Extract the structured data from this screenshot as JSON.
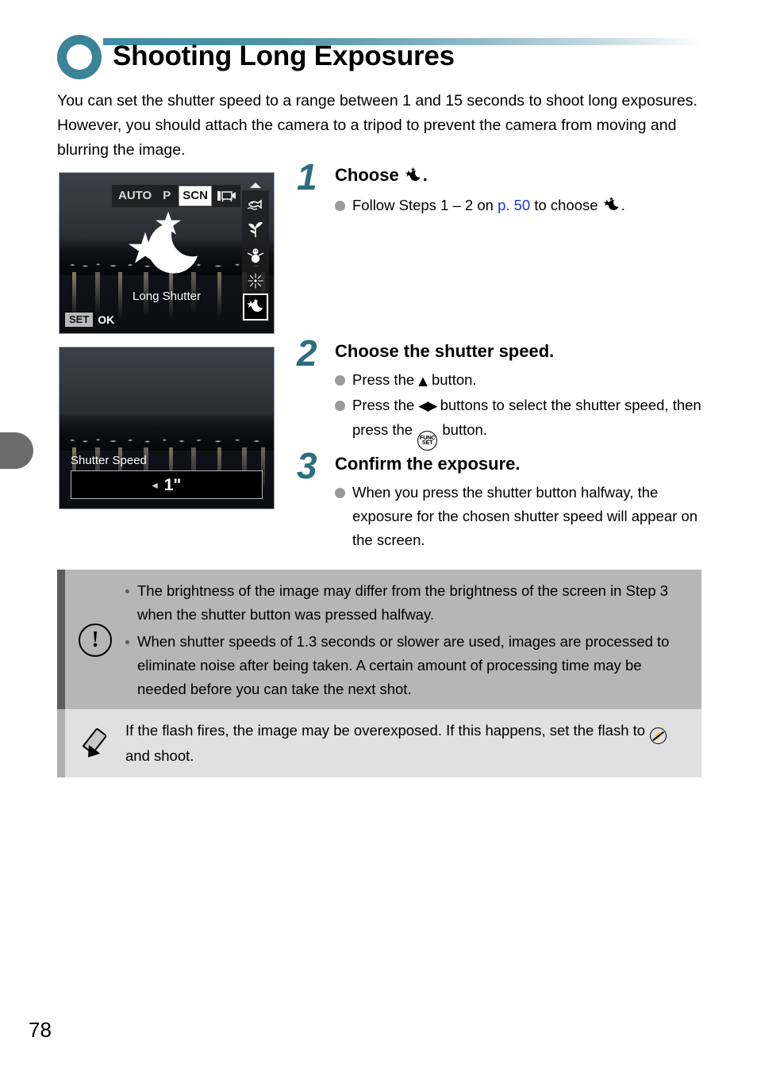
{
  "page": {
    "number": "78",
    "chapter_tab": "chapter-marker"
  },
  "header": {
    "icon": "circle-ring-icon",
    "title": "Shooting Long Exposures"
  },
  "intro": {
    "text": "You can set the shutter speed to a range between 1 and 15 seconds to shoot long exposures. However, you should attach the camera to a tripod to prevent the camera from moving and blurring the image."
  },
  "screenshot_1": {
    "name": "camera-scene-mode-screen",
    "mode_bar": {
      "items": [
        {
          "label": "AUTO",
          "selected": false
        },
        {
          "label": "P",
          "selected": false
        },
        {
          "label": "SCN",
          "selected": true
        }
      ],
      "movie_icon": "movie-mode-icon"
    },
    "scene_icons": [
      {
        "name": "underwater-icon",
        "glyph": "🐟",
        "active": false
      },
      {
        "name": "foliage-icon",
        "glyph": "❦",
        "active": false
      },
      {
        "name": "snow-icon",
        "glyph": "☃",
        "active": false
      },
      {
        "name": "fireworks-icon",
        "glyph": "✹",
        "active": false
      },
      {
        "name": "long-shutter-icon",
        "glyph": "✯☾",
        "active": true
      }
    ],
    "scroll_arrow": "scroll-up-arrow",
    "center_icon": "long-shutter-star-moon-icon",
    "mode_label": "Long Shutter",
    "set_chip": "SET",
    "ok_label": "OK"
  },
  "screenshot_2": {
    "name": "shutter-speed-screen",
    "label": "Shutter Speed",
    "left_arrow": "◂",
    "value": "1\""
  },
  "steps": [
    {
      "number": "1",
      "title_prefix": "Choose ",
      "title_icon": "long-shutter-star-moon-icon",
      "title_suffix": ".",
      "bullets": [
        {
          "parts": [
            {
              "type": "text",
              "value": "Follow Steps 1 – 2 on "
            },
            {
              "type": "link",
              "value": "p. 50"
            },
            {
              "type": "text",
              "value": " to choose "
            },
            {
              "type": "icon",
              "value": "long-shutter-star-moon-icon"
            },
            {
              "type": "text",
              "value": "."
            }
          ]
        }
      ]
    },
    {
      "number": "2",
      "title": "Choose the shutter speed.",
      "bullets": [
        {
          "parts": [
            {
              "type": "text",
              "value": "Press the "
            },
            {
              "type": "icon",
              "value": "up-arrow-button-icon"
            },
            {
              "type": "text",
              "value": " button."
            }
          ]
        },
        {
          "parts": [
            {
              "type": "text",
              "value": "Press the "
            },
            {
              "type": "icon",
              "value": "left-right-arrow-buttons-icon"
            },
            {
              "type": "text",
              "value": " buttons to select the shutter speed, then press the "
            },
            {
              "type": "icon",
              "value": "func-set-button-icon"
            },
            {
              "type": "text",
              "value": " button."
            }
          ]
        }
      ]
    },
    {
      "number": "3",
      "title": "Confirm the exposure.",
      "bullets": [
        {
          "parts": [
            {
              "type": "text",
              "value": "When you press the shutter button halfway, the exposure for the chosen shutter speed will appear on the screen."
            }
          ]
        }
      ]
    }
  ],
  "caution_box": {
    "icon": "exclamation-circle-icon",
    "icon_glyph": "!",
    "items": [
      "The brightness of the image may differ from the brightness of the screen in Step 3 when the shutter button was pressed halfway.",
      "When shutter speeds of 1.3 seconds or slower are used, images are processed to eliminate noise after being taken. A certain amount of processing time may be needed before you can take the next shot."
    ]
  },
  "note_box": {
    "icon": "pencil-icon",
    "text_before": "If the flash fires, the image may be overexposed. If this happens, set the flash to ",
    "flash_icon": "flash-off-icon",
    "text_after": " and shoot."
  },
  "colors": {
    "accent_teal": "#2d6e7e",
    "header_ring": "#3a8399",
    "link_blue": "#1a33e0",
    "caution_bg": "#b6b6b6",
    "caution_accent": "#5c5c5c",
    "note_bg": "#e0e0e0",
    "note_accent": "#b0b0b0",
    "chapter_tab": "#6b6b6b"
  }
}
